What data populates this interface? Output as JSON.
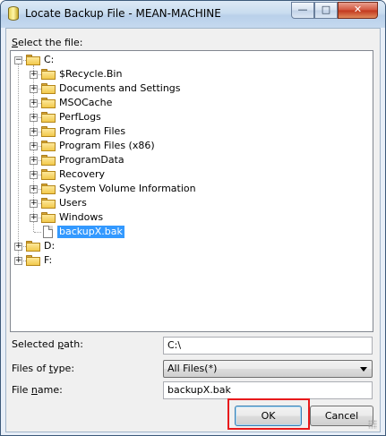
{
  "window": {
    "title": "Locate Backup File - MEAN-MACHINE",
    "minimize_glyph": "—",
    "maximize_glyph": "□",
    "close_glyph": "✕"
  },
  "select_label_prefix": "S",
  "select_label_rest": "elect the file:",
  "tree": {
    "expand_glyph": "+",
    "collapse_glyph": "−",
    "items": [
      {
        "label": "C:",
        "type": "drive",
        "expanded": true
      },
      {
        "label": "$Recycle.Bin",
        "type": "folder"
      },
      {
        "label": "Documents and Settings",
        "type": "folder"
      },
      {
        "label": "MSOCache",
        "type": "folder"
      },
      {
        "label": "PerfLogs",
        "type": "folder"
      },
      {
        "label": "Program Files",
        "type": "folder"
      },
      {
        "label": "Program Files (x86)",
        "type": "folder"
      },
      {
        "label": "ProgramData",
        "type": "folder"
      },
      {
        "label": "Recovery",
        "type": "folder"
      },
      {
        "label": "System Volume Information",
        "type": "folder"
      },
      {
        "label": "Users",
        "type": "folder"
      },
      {
        "label": "Windows",
        "type": "folder"
      },
      {
        "label": "backupX.bak",
        "type": "file",
        "selected": true
      },
      {
        "label": "D:",
        "type": "drive"
      },
      {
        "label": "F:",
        "type": "drive"
      }
    ]
  },
  "selected_path": {
    "label_prefix": "Selected ",
    "label_u": "p",
    "label_rest": "ath:",
    "value": "C:\\"
  },
  "files_of_type": {
    "label_prefix": "Files of ",
    "label_u": "t",
    "label_rest": "ype:",
    "value": "All Files(*)"
  },
  "file_name": {
    "label_prefix": "File ",
    "label_u": "n",
    "label_rest": "ame:",
    "value": "backupX.bak"
  },
  "buttons": {
    "ok": "OK",
    "cancel": "Cancel"
  },
  "colors": {
    "selection": "#3399ff",
    "highlight": "#e8191b",
    "folder": "#f2c94c"
  }
}
